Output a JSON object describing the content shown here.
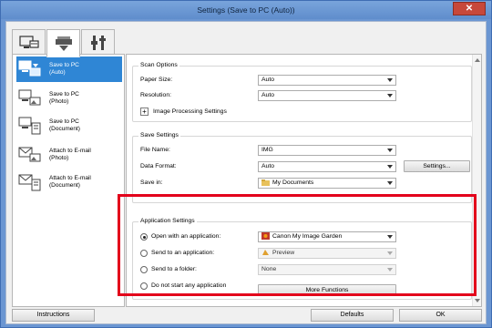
{
  "window": {
    "title": "Settings (Save to PC (Auto))",
    "close_glyph": "✕"
  },
  "tabs": [
    {
      "icon": "scanner-computer-icon",
      "active": false
    },
    {
      "icon": "scanner-icon",
      "active": true
    },
    {
      "icon": "tools-icon",
      "active": false
    }
  ],
  "nav": {
    "items": [
      {
        "label_line1": "Save to PC",
        "label_line2": "(Auto)",
        "active": true
      },
      {
        "label_line1": "Save to PC",
        "label_line2": "(Photo)",
        "active": false
      },
      {
        "label_line1": "Save to PC",
        "label_line2": "(Document)",
        "active": false
      },
      {
        "label_line1": "Attach to E-mail",
        "label_line2": "(Photo)",
        "active": false
      },
      {
        "label_line1": "Attach to E-mail",
        "label_line2": "(Document)",
        "active": false
      }
    ]
  },
  "scan_options": {
    "title": "Scan Options",
    "paper_size_label": "Paper Size:",
    "paper_size_value": "Auto",
    "resolution_label": "Resolution:",
    "resolution_value": "Auto",
    "image_processing_label": "Image Processing Settings",
    "expand_glyph": "+"
  },
  "save_settings": {
    "title": "Save Settings",
    "file_name_label": "File Name:",
    "file_name_value": "IMG",
    "data_format_label": "Data Format:",
    "data_format_value": "Auto",
    "settings_button": "Settings...",
    "save_in_label": "Save in:",
    "save_in_value": "My Documents"
  },
  "app_settings": {
    "title": "Application Settings",
    "open_with_label": "Open with an application:",
    "open_with_value": "Canon My Image Garden",
    "send_to_app_label": "Send to an application:",
    "send_to_app_value": "Preview",
    "send_to_folder_label": "Send to a folder:",
    "send_to_folder_value": "None",
    "do_not_start_label": "Do not start any application",
    "more_functions_button": "More Functions",
    "selected_option": "open_with"
  },
  "footer": {
    "instructions": "Instructions",
    "defaults": "Defaults",
    "ok": "OK"
  },
  "colors": {
    "accent": "#2f86d5",
    "highlight": "#e3001b",
    "title_bar": "#6b96d2"
  }
}
